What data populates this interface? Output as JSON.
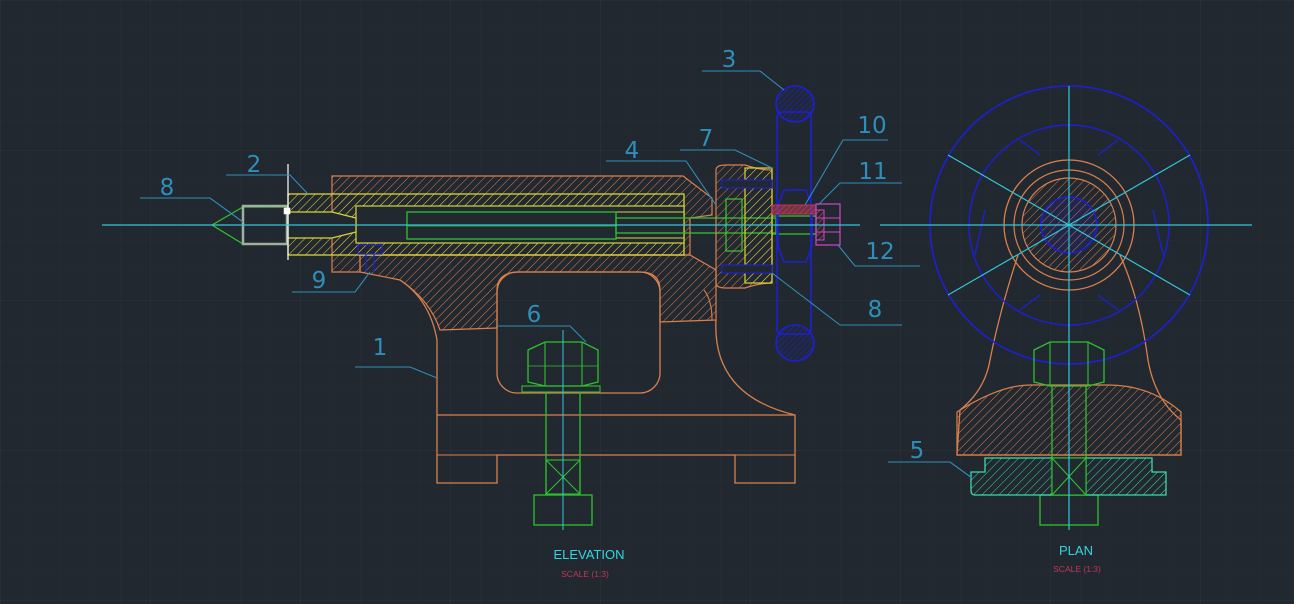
{
  "colors": {
    "background": "#212830",
    "grid_minor": "#262d36",
    "grid_major": "#2c343e",
    "centerline": "#33c6d6",
    "body": "#d9804d",
    "sleeve": "#d8d43a",
    "spindle": "#2ec12e",
    "handwheel": "#1c20d6",
    "key": "#b83a55",
    "nut": "#d246c8",
    "base_plate": "#3fd9aa",
    "leader": "#2f8fba",
    "title": "#33d6e0",
    "scale": "#c0365b"
  },
  "views": {
    "elevation": {
      "title": "ELEVATION",
      "scale": "SCALE (1:3)"
    },
    "plan": {
      "title": "PLAN",
      "scale": "SCALE (1:3)"
    }
  },
  "balloons": [
    "1",
    "2",
    "3",
    "4",
    "5",
    "6",
    "7",
    "8",
    "8",
    "9",
    "10",
    "11",
    "12"
  ]
}
